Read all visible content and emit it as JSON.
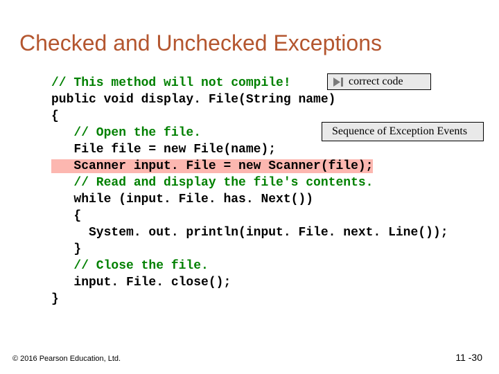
{
  "title": "Checked and Unchecked Exceptions",
  "buttons": {
    "correct": "correct code",
    "seq": "Sequence of Exception Events"
  },
  "code": {
    "l01a": "// This method will not compile!",
    "l02": "public void display. File(String name)",
    "l03": "{",
    "l04": "   // Open the file.",
    "l05": "   File file = new File(name);",
    "l06": "   Scanner input. File = new Scanner(file);",
    "l07": "   // Read and display the file's contents.",
    "l08": "   while (input. File. has. Next())",
    "l09": "   {",
    "l10": "     System. out. println(input. File. next. Line());",
    "l11": "   }",
    "l12": "   // Close the file.",
    "l13": "   input. File. close();",
    "l14": "}"
  },
  "footer": {
    "left": "© 2016 Pearson Education, Ltd.",
    "right": "11 -30"
  }
}
